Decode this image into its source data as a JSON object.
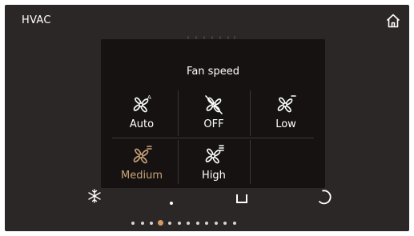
{
  "app": {
    "title": "HVAC"
  },
  "header": {
    "home_icon": "home-icon"
  },
  "fan_speed": {
    "title": "Fan speed",
    "options": [
      {
        "label": "Auto",
        "icon": "fan-auto-icon",
        "selected": false
      },
      {
        "label": "OFF",
        "icon": "fan-off-icon",
        "selected": false
      },
      {
        "label": "Low",
        "icon": "fan-low-icon",
        "selected": false
      },
      {
        "label": "Medium",
        "icon": "fan-medium-icon",
        "selected": true
      },
      {
        "label": "High",
        "icon": "fan-high-icon",
        "selected": false
      }
    ]
  },
  "pagination": {
    "count": 12,
    "active_index": 3
  },
  "colors": {
    "background": "#2c2727",
    "popup": "#161212",
    "accent": "#c9a27a",
    "active_dot": "#d49a62",
    "text": "#ffffff"
  }
}
